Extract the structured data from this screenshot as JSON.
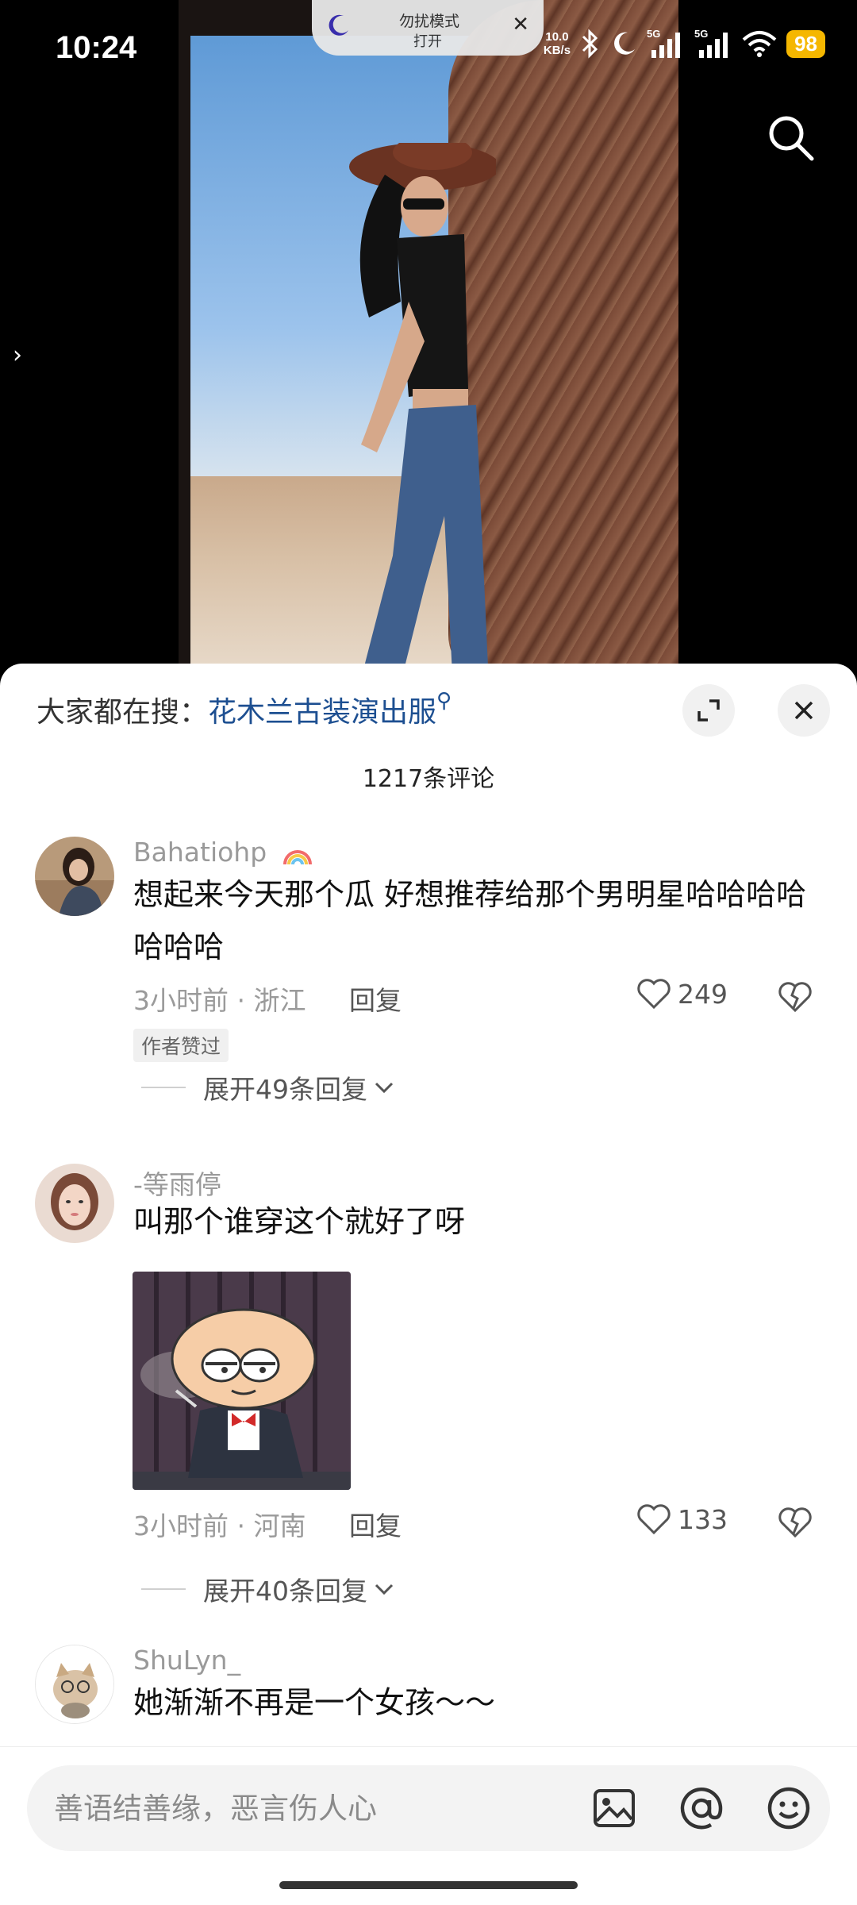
{
  "status_bar": {
    "time": "10:24",
    "net_speed_value": "10.0",
    "net_speed_unit": "KB/s",
    "battery": "98",
    "dnd_title": "勿扰模式",
    "dnd_subtitle": "打开"
  },
  "sheet": {
    "hot_search_prefix": "大家都在搜：",
    "hot_search_term": "花木兰古装演出服",
    "comment_count": "1217条评论"
  },
  "comments": [
    {
      "username": "Bahatiohp",
      "text": "想起来今天那个瓜 好想推荐给那个男明星哈哈哈哈哈哈哈",
      "time": "3小时前",
      "location": "浙江",
      "reply_label": "回复",
      "likes": "249",
      "badge": "作者赞过",
      "expand_replies": "展开49条回复"
    },
    {
      "username": "-等雨停",
      "text": "叫那个谁穿这个就好了呀",
      "time": "3小时前",
      "location": "河南",
      "reply_label": "回复",
      "likes": "133",
      "expand_replies": "展开40条回复"
    },
    {
      "username": "ShuLyn_",
      "text": "她渐渐不再是一个女孩～～"
    }
  ],
  "input": {
    "placeholder": "善语结善缘，恶言伤人心"
  },
  "icons": [
    "moon-icon",
    "search-icon",
    "chevron-right-icon",
    "expand-icon",
    "close-icon",
    "heart-icon",
    "broken-heart-icon",
    "chevron-down-icon",
    "image-icon",
    "at-icon",
    "emoji-icon",
    "rainbow-icon"
  ],
  "colors": {
    "accent_link": "#1d4f91",
    "battery": "#f5b700"
  }
}
